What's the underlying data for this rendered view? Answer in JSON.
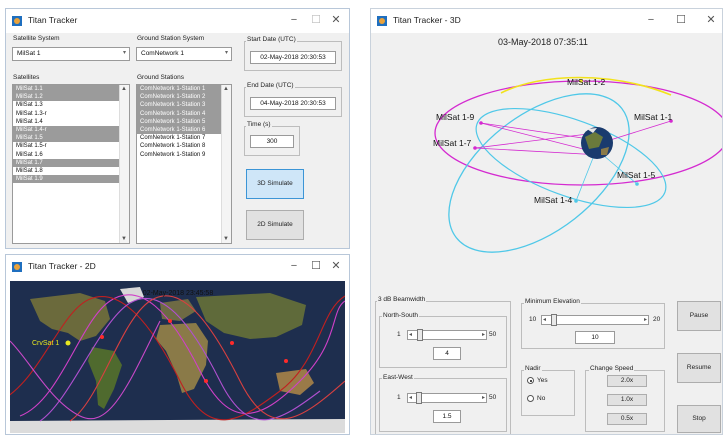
{
  "main_window": {
    "title": "Titan Tracker",
    "satellite_system_label": "Satellite System",
    "satellite_system_value": "MilSat 1",
    "ground_station_system_label": "Ground Station System",
    "ground_station_system_value": "ComNetwork 1",
    "satellites_label": "Satellites",
    "satellites": [
      {
        "name": "MilSat 1.1",
        "selected": true
      },
      {
        "name": "MilSat 1.2",
        "selected": true
      },
      {
        "name": "MilSat 1.3",
        "selected": false
      },
      {
        "name": "MilSat 1.3-r",
        "selected": false
      },
      {
        "name": "MilSat 1.4",
        "selected": false
      },
      {
        "name": "MilSat 1.4-r",
        "selected": true
      },
      {
        "name": "MilSat 1.5",
        "selected": true
      },
      {
        "name": "MilSat 1.5-r",
        "selected": false
      },
      {
        "name": "MilSat 1.6",
        "selected": false
      },
      {
        "name": "MilSat 1.7",
        "selected": true
      },
      {
        "name": "MilSat 1.8",
        "selected": false
      },
      {
        "name": "MilSat 1.9",
        "selected": true
      }
    ],
    "ground_stations_label": "Ground Stations",
    "ground_stations": [
      {
        "name": "ComNetwork 1-Station 1",
        "selected": true
      },
      {
        "name": "ComNetwork 1-Station 2",
        "selected": true
      },
      {
        "name": "ComNetwork 1-Station 3",
        "selected": true
      },
      {
        "name": "ComNetwork 1-Station 4",
        "selected": true
      },
      {
        "name": "ComNetwork 1-Station 5",
        "selected": true
      },
      {
        "name": "ComNetwork 1-Station 6",
        "selected": true
      },
      {
        "name": "ComNetwork 1-Station 7",
        "selected": false
      },
      {
        "name": "ComNetwork 1-Station 8",
        "selected": false
      },
      {
        "name": "ComNetwork 1-Station 9",
        "selected": false
      }
    ],
    "start_date_label": "Start Date (UTC)",
    "start_date_value": "02-May-2018 20:30:53",
    "end_date_label": "End Date (UTC)",
    "end_date_value": "04-May-2018 20:30:53",
    "time_label": "Time (s)",
    "time_value": "300",
    "simulate_3d_label": "3D Simulate",
    "simulate_2d_label": "2D Simulate"
  },
  "window_2d": {
    "title": "Titan Tracker - 2D",
    "timestamp": "02-May-2018 23:45:58",
    "sat_label": "CrvSat 1"
  },
  "window_3d": {
    "title": "Titan Tracker - 3D",
    "timestamp": "03-May-2018 07:35:11",
    "satellites": [
      "MilSat 1-2",
      "MilSat 1-9",
      "MilSat 1-1",
      "MilSat 1-7",
      "MilSat 1-5",
      "MilSat 1-4"
    ],
    "beamwidth_label": "3 dB Beamwidth",
    "north_south_label": "North-South",
    "ns_min": "1",
    "ns_max": "50",
    "ns_value": "4",
    "east_west_label": "East-West",
    "ew_min": "1",
    "ew_max": "50",
    "ew_value": "1.5",
    "min_elevation_label": "Minimum Elevation",
    "elev_min": "10",
    "elev_max": "20",
    "elev_value": "10",
    "nadir_label": "Nadir",
    "nadir_yes": "Yes",
    "nadir_no": "No",
    "change_speed_label": "Change Speed",
    "speed_2x": "2.0x",
    "speed_1x": "1.0x",
    "speed_05x": "0.5x",
    "pause_label": "Pause",
    "resume_label": "Resume",
    "stop_label": "Stop"
  },
  "window_controls": {
    "minimize": "−",
    "maximize": "☐",
    "close": "✕"
  },
  "colors": {
    "selection": "#9b9b9b",
    "button_blue": "#cfe6f8",
    "orbit_magenta": "#d42ad0",
    "orbit_cyan": "#4fc8e8",
    "orbit_yellow": "#f2e21c"
  }
}
